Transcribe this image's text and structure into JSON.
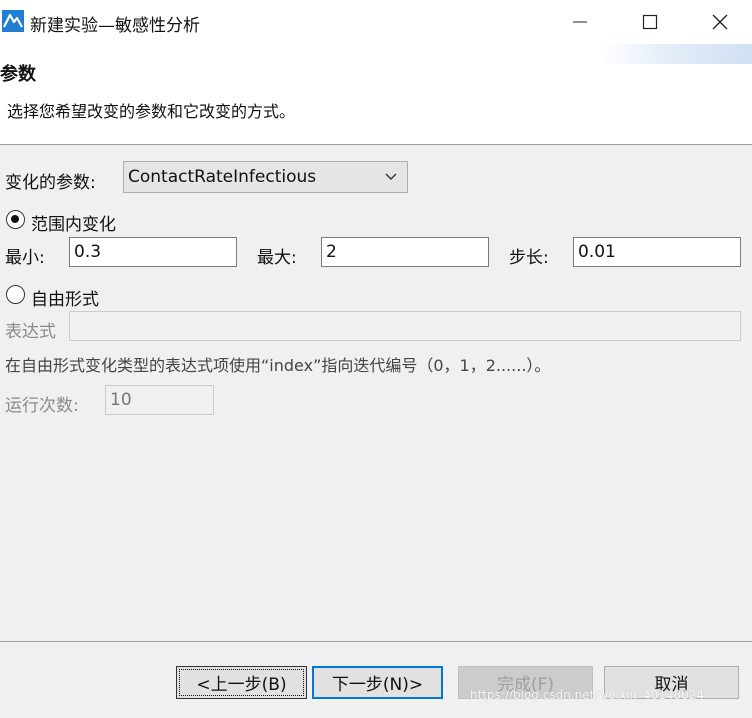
{
  "window": {
    "title": "新建实验—敏感性分析",
    "icon": "anylogic-logo-icon",
    "controls": [
      "minimize-icon",
      "maximize-icon",
      "close-icon"
    ]
  },
  "header": {
    "title": "参数",
    "description": "选择您希望改变的参数和它改变的方式。"
  },
  "parameter": {
    "label": "变化的参数:",
    "selected": "ContactRateInfectious"
  },
  "range_mode": {
    "label": "范围内变化",
    "selected": true,
    "min_label": "最小:",
    "min_value": "0.3",
    "max_label": "最大:",
    "max_value": "2",
    "step_label": "步长:",
    "step_value": "0.01"
  },
  "freeform_mode": {
    "label": "自由形式",
    "selected": false,
    "expression_label": "表达式",
    "expression_value": "",
    "hint": "在自由形式变化类型的表达式项使用“index”指向迭代编号（0，1，2......）。",
    "runs_label": "运行次数:",
    "runs_value": "10"
  },
  "buttons": {
    "back": "<上一步(B)",
    "next": "下一步(N)>",
    "finish": "完成(F)",
    "cancel": "取消"
  },
  "watermark": "https://blog.csdn.net/weixin_40148024",
  "colors": {
    "accent": "#0078d7",
    "logo": "#1f7fd1",
    "disabled_text": "#8a8a8a"
  }
}
